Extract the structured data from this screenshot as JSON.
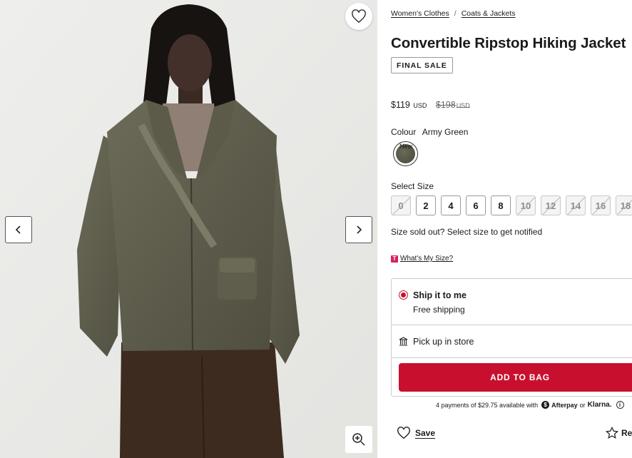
{
  "breadcrumb": {
    "items": [
      "Women's Clothes",
      "Coats & Jackets"
    ],
    "separator": "/"
  },
  "product": {
    "title": "Convertible Ripstop Hiking Jacket",
    "badge": "FINAL SALE",
    "price": "$119",
    "currency": "USD",
    "original_price": "$198",
    "original_currency": "USD"
  },
  "colour": {
    "label": "Colour",
    "value": "Army Green",
    "swatch_tag": "New",
    "swatch_color": "#55554a"
  },
  "size": {
    "label": "Select Size",
    "options": [
      {
        "label": "0",
        "available": false
      },
      {
        "label": "2",
        "available": true
      },
      {
        "label": "4",
        "available": true
      },
      {
        "label": "6",
        "available": true
      },
      {
        "label": "8",
        "available": true
      },
      {
        "label": "10",
        "available": false
      },
      {
        "label": "12",
        "available": false
      },
      {
        "label": "14",
        "available": false
      },
      {
        "label": "16",
        "available": false
      },
      {
        "label": "18",
        "available": false
      }
    ],
    "sold_out_note": "Size sold out? Select size to get notified",
    "guide_icon": "T",
    "guide_link": "What's My Size?"
  },
  "shipping": {
    "ship_title": "Ship it to me",
    "ship_sub": "Free shipping",
    "pickup_label": "Pick up in store",
    "selected": "ship"
  },
  "actions": {
    "add_to_bag": "ADD TO BAG",
    "save": "Save",
    "review": "Re"
  },
  "payments": {
    "text": "4 payments of $29.75 available with",
    "afterpay": "Afterpay",
    "or": "or",
    "klarna": "Klarna."
  },
  "colors": {
    "accent": "#c8102e",
    "text": "#1a1a1a",
    "gallery_bg": "#ececea"
  }
}
